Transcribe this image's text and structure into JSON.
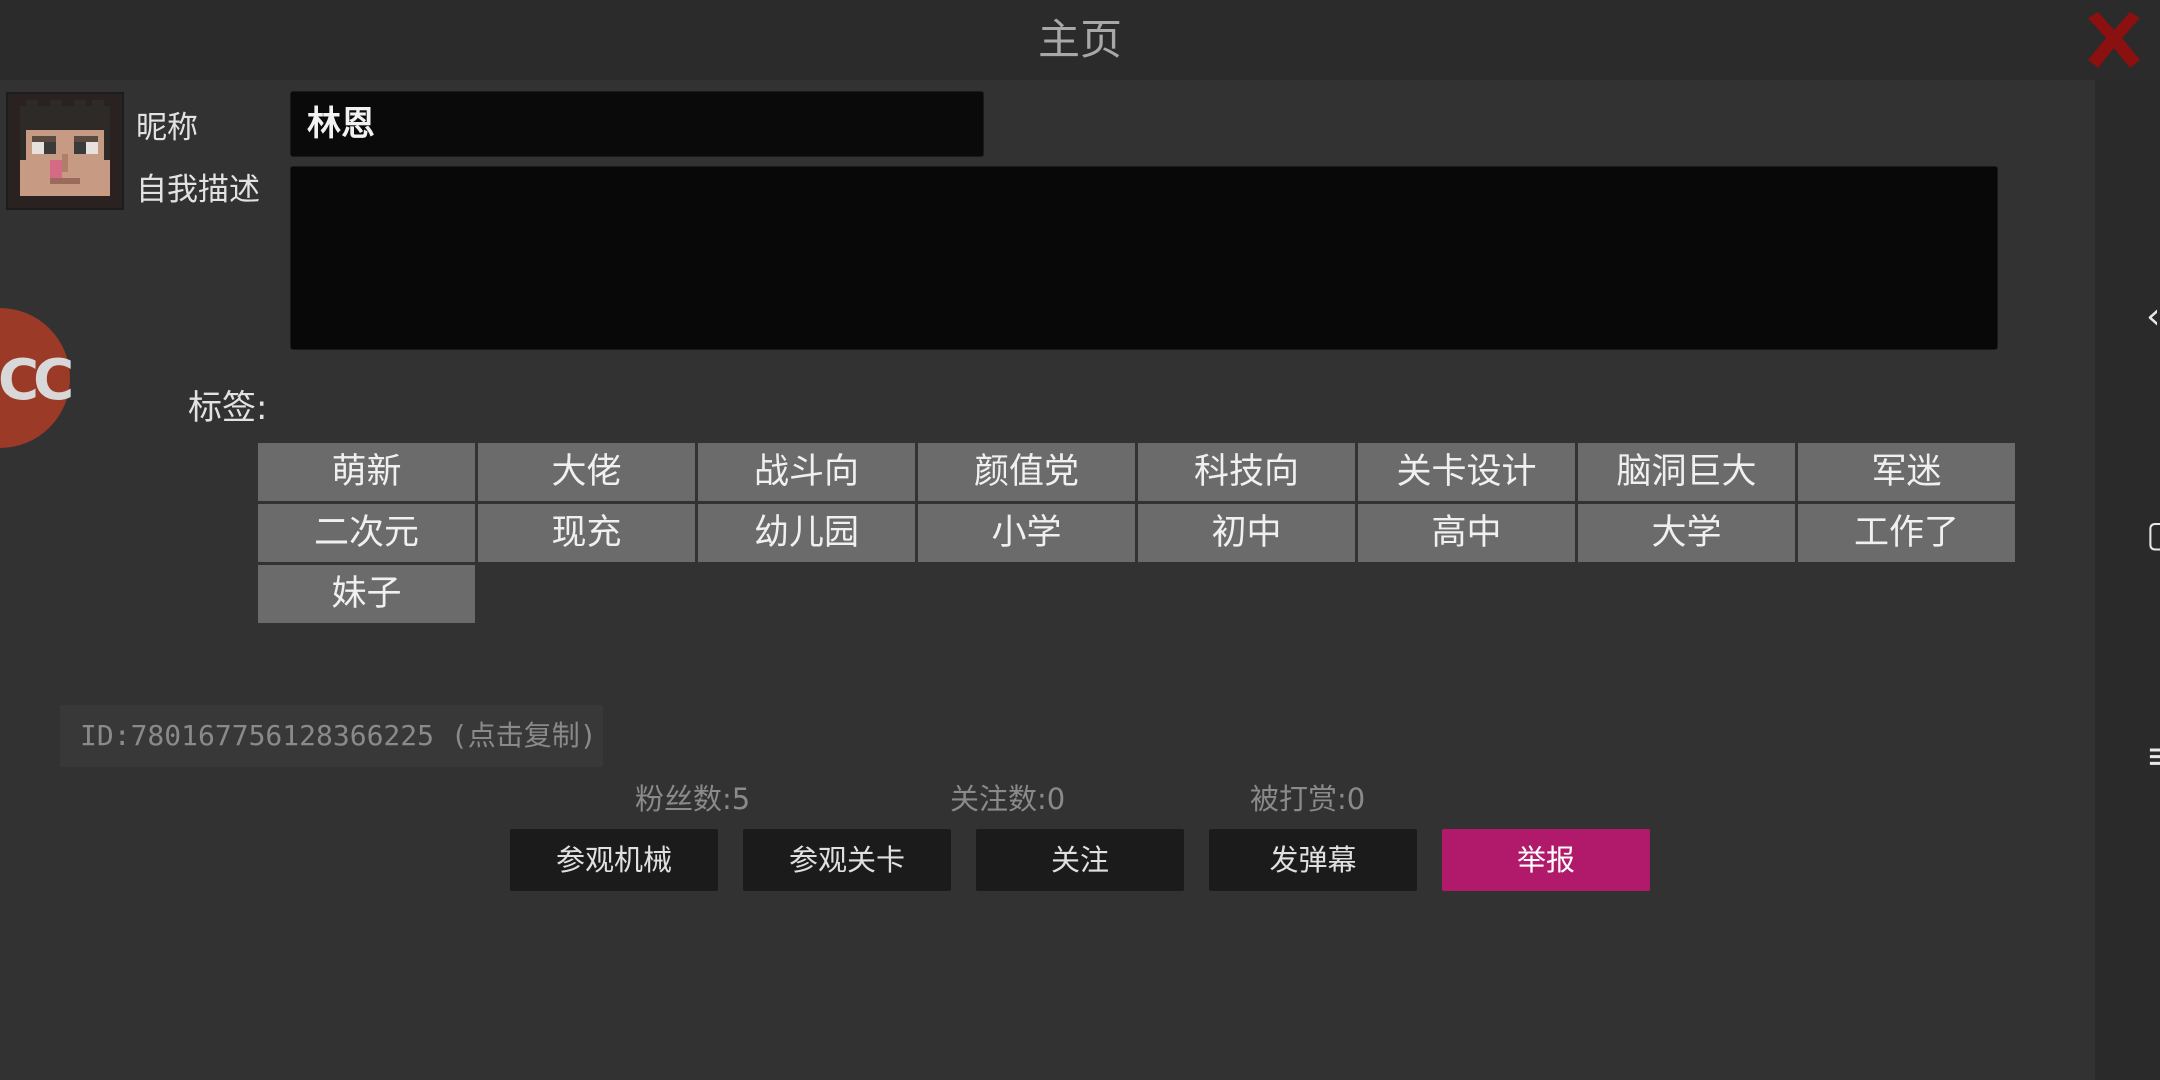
{
  "header": {
    "title": "主页",
    "close_icon": "close-x-icon",
    "close_color": "#8b1010"
  },
  "profile": {
    "avatar_icon": "pixel-face-avatar",
    "nickname_label": "昵称",
    "nickname_value": "林恩",
    "description_label": "自我描述",
    "description_value": "",
    "badge_icon": "cc-badge-icon",
    "badge_text": "CC"
  },
  "tags": {
    "label": "标签:",
    "items": [
      "萌新",
      "大佬",
      "战斗向",
      "颜值党",
      "科技向",
      "关卡设计",
      "脑洞巨大",
      "军迷",
      "二次元",
      "现充",
      "幼儿园",
      "小学",
      "初中",
      "高中",
      "大学",
      "工作了",
      "妹子"
    ]
  },
  "user_id": {
    "text": "ID:780167756128366225 (点击复制)"
  },
  "stats": {
    "fans": "粉丝数:5",
    "following": "关注数:0",
    "rewarded": "被打赏:0"
  },
  "actions": {
    "view_machines": "参观机械",
    "view_levels": "参观关卡",
    "follow": "关注",
    "send_danmaku": "发弹幕",
    "report": "举报",
    "report_color": "#b1196a"
  },
  "side_strip": {
    "glyphs": [
      "‹",
      "▢",
      "≡"
    ]
  }
}
